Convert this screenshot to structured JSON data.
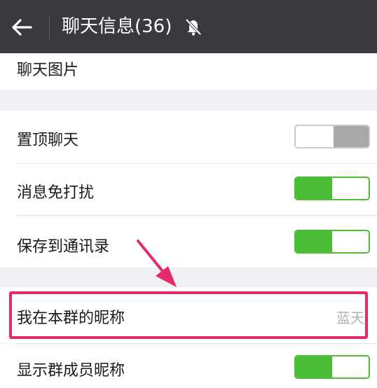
{
  "header": {
    "title": "聊天信息(36)",
    "icons": {
      "back": "back-arrow-icon",
      "mute": "bell-muted-icon"
    }
  },
  "rows": {
    "chat_images": {
      "label": "聊天图片"
    },
    "pin_chat": {
      "label": "置顶聊天",
      "toggle": "off"
    },
    "mute_notifications": {
      "label": "消息免打扰",
      "toggle": "on"
    },
    "save_to_contacts": {
      "label": "保存到通讯录",
      "toggle": "on"
    },
    "my_group_nickname": {
      "label": "我在本群的昵称",
      "value": "蓝天"
    },
    "show_member_nicknames": {
      "label": "显示群成员昵称",
      "toggle": "on"
    }
  },
  "colors": {
    "header_bg": "#393a3f",
    "toggle_on": "#4cbd36",
    "toggle_off": "#a8a8a8",
    "highlight": "#e62a6a",
    "page_bg": "#efeff4"
  }
}
